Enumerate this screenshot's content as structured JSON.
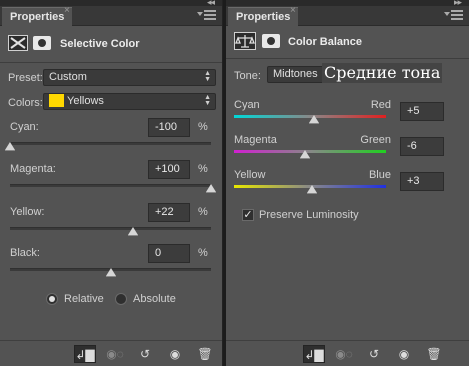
{
  "left_panel": {
    "tab_label": "Properties",
    "tab_close": "×",
    "title": "Selective Color",
    "preset": {
      "label": "Preset:",
      "value": "Custom"
    },
    "colors": {
      "label": "Colors:",
      "value": "Yellows",
      "swatch_color": "#ffd800"
    },
    "sliders": [
      {
        "label": "Cyan:",
        "value": "-100",
        "unit": "%",
        "level": -100
      },
      {
        "label": "Magenta:",
        "value": "+100",
        "unit": "%",
        "level": 100
      },
      {
        "label": "Yellow:",
        "value": "+22",
        "unit": "%",
        "level": 22
      },
      {
        "label": "Black:",
        "value": "0",
        "unit": "%",
        "level": 0
      }
    ],
    "method": {
      "relative_label": "Relative",
      "absolute_label": "Absolute",
      "selected": "Relative"
    }
  },
  "right_panel": {
    "tab_label": "Properties",
    "tab_close": "×",
    "title": "Color Balance",
    "tone": {
      "label": "Tone:",
      "value": "Midtones"
    },
    "overlay_text": "Средние тона",
    "sliders": [
      {
        "left": "Cyan",
        "right": "Red",
        "value": "+5",
        "level": 5,
        "colors": [
          "#00d8d8",
          "#e02020"
        ]
      },
      {
        "left": "Magenta",
        "right": "Green",
        "value": "-6",
        "level": -6,
        "colors": [
          "#d020d0",
          "#20d020"
        ]
      },
      {
        "left": "Yellow",
        "right": "Blue",
        "value": "+3",
        "level": 3,
        "colors": [
          "#e8e800",
          "#2030e0"
        ]
      }
    ],
    "preserve_luminosity": {
      "label": "Preserve Luminosity",
      "checked": true
    }
  },
  "footer_icons": [
    "clip-to-layer-icon",
    "view-previous-icon",
    "reset-icon",
    "visibility-eye-icon",
    "delete-trash-icon"
  ]
}
